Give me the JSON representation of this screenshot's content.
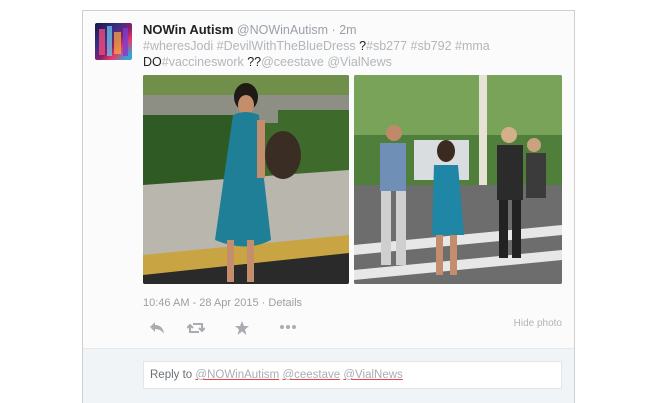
{
  "tweet": {
    "display_name": "NOWin Autism",
    "handle": "@NOWinAutism",
    "separator": "·",
    "age": "2m",
    "text_parts": [
      {
        "text": "#wheresJodi ",
        "style": "hashtag"
      },
      {
        "text": "#DevilWithTheBlueDress ",
        "style": "hashtag"
      },
      {
        "text": "?",
        "style": "dark"
      },
      {
        "text": "#sb277 ",
        "style": "hashtag"
      },
      {
        "text": "#sb792 ",
        "style": "hashtag"
      },
      {
        "text": "#mma ",
        "style": "hashtag"
      },
      {
        "text": "DO",
        "style": "dark"
      },
      {
        "text": "#vaccineswork ",
        "style": "hashtag"
      },
      {
        "text": "??",
        "style": "dark"
      },
      {
        "text": "@ceestave ",
        "style": "hashtag"
      },
      {
        "text": "@VialNews",
        "style": "hashtag"
      }
    ],
    "timestamp": "10:46 AM - 28 Apr 2015",
    "meta_separator": "·",
    "details_label": "Details",
    "hide_photo_label": "Hide photo"
  },
  "actions": {
    "reply_icon": "reply-icon",
    "retweet_icon": "retweet-icon",
    "favorite_icon": "star-icon",
    "more_icon": "more-icon"
  },
  "reply": {
    "prefix": "Reply to",
    "mentions": [
      "@NOWinAutism",
      "@ceestave",
      "@VialNews"
    ]
  },
  "colors": {
    "dress_blue": "#1f7f96",
    "hashtag_grey": "#b2b7bb"
  }
}
